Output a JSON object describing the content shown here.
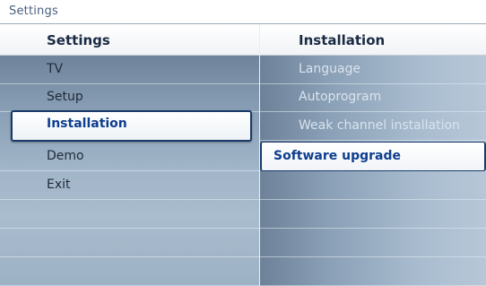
{
  "breadcrumb": "Settings",
  "left_panel": {
    "title": "Settings",
    "items": [
      {
        "label": "TV"
      },
      {
        "label": "Setup"
      },
      {
        "label": "Installation"
      },
      {
        "label": "Demo"
      },
      {
        "label": "Exit"
      }
    ],
    "selected_index": 2
  },
  "right_panel": {
    "title": "Installation",
    "items": [
      {
        "label": "Language"
      },
      {
        "label": "Autoprogram"
      },
      {
        "label": "Weak channel installation"
      },
      {
        "label": "Software upgrade"
      }
    ],
    "highlighted_index": 3
  },
  "colors": {
    "accent_text": "#0e3e8e",
    "selection_border": "#1a3a6a",
    "panel_blue": "#8aa0b6"
  }
}
